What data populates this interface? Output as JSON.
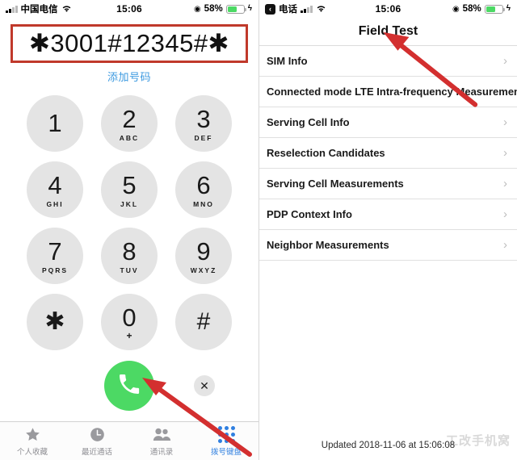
{
  "left": {
    "status": {
      "bars_icon": "signal-bars-icon",
      "carrier": "中国电信",
      "wifi_icon": "wifi-icon",
      "time": "15:06",
      "location_icon": "location-services-icon",
      "battery_percent": "58%",
      "battery_level": 58,
      "charging_icon": "lightning-bolt-icon"
    },
    "dialer": {
      "number": "✱3001#12345#✱",
      "add_number_label": "添加号码",
      "highlight_color": "#c0392b",
      "add_number_color": "#3d9ae0"
    },
    "keypad": [
      {
        "digit": "1",
        "letters": ""
      },
      {
        "digit": "2",
        "letters": "ABC"
      },
      {
        "digit": "3",
        "letters": "DEF"
      },
      {
        "digit": "4",
        "letters": "GHI"
      },
      {
        "digit": "5",
        "letters": "JKL"
      },
      {
        "digit": "6",
        "letters": "MNO"
      },
      {
        "digit": "7",
        "letters": "PQRS"
      },
      {
        "digit": "8",
        "letters": "TUV"
      },
      {
        "digit": "9",
        "letters": "WXYZ"
      },
      {
        "digit": "✱",
        "letters": ""
      },
      {
        "digit": "0",
        "letters": "+"
      },
      {
        "digit": "#",
        "letters": ""
      }
    ],
    "actions": {
      "call_icon": "phone-handset-icon",
      "call_color": "#4cd964",
      "delete_icon": "close-x-icon",
      "delete_label": "✕"
    },
    "tabs": [
      {
        "label": "个人收藏",
        "icon": "star-icon",
        "active": false
      },
      {
        "label": "最近通话",
        "icon": "clock-icon",
        "active": false
      },
      {
        "label": "通讯录",
        "icon": "contacts-icon",
        "active": false
      },
      {
        "label": "拨号键盘",
        "icon": "keypad-dots-icon",
        "active": true
      }
    ],
    "tab_active_color": "#2f7fe0"
  },
  "right": {
    "status": {
      "back_icon": "back-chevron-icon",
      "back_label": "电话",
      "bars_icon": "signal-bars-icon",
      "wifi_icon": "wifi-icon",
      "time": "15:06",
      "location_icon": "location-services-icon",
      "battery_percent": "58%",
      "battery_level": 58,
      "charging_icon": "lightning-bolt-icon"
    },
    "title": "Field Test",
    "rows": [
      {
        "label": "SIM Info",
        "chevron": "chevron-right-icon"
      },
      {
        "label": "Connected mode LTE Intra-frequency Measurements",
        "chevron": "chevron-right-icon"
      },
      {
        "label": "Serving Cell Info",
        "chevron": "chevron-right-icon"
      },
      {
        "label": "Reselection Candidates",
        "chevron": "chevron-right-icon"
      },
      {
        "label": "Serving Cell Measurements",
        "chevron": "chevron-right-icon"
      },
      {
        "label": "PDP Context Info",
        "chevron": "chevron-right-icon"
      },
      {
        "label": "Neighbor Measurements",
        "chevron": "chevron-right-icon"
      }
    ],
    "updated": "Updated 2018-11-06 at 15:06:08",
    "watermark": "工改手机窝"
  },
  "annotations": {
    "arrow_color": "#d32f2f",
    "left_arrow_name": "call-button-arrow",
    "right_arrow_name": "field-test-title-arrow"
  }
}
